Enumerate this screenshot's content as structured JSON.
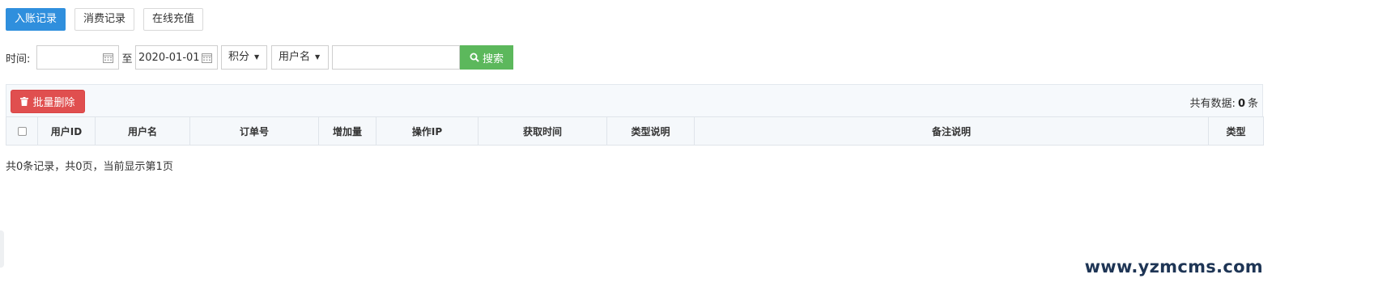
{
  "tabs": [
    {
      "label": "入账记录",
      "active": true
    },
    {
      "label": "消费记录",
      "active": false
    },
    {
      "label": "在线充值",
      "active": false
    }
  ],
  "search": {
    "time_label": "时间:",
    "start_date": "",
    "to_label": "至",
    "end_date": "2020-01-01",
    "type_select": "积分",
    "field_select": "用户名",
    "keyword": "",
    "search_button": "搜索"
  },
  "toolbar": {
    "batch_delete": "批量删除",
    "total_prefix": "共有数据:",
    "total_count": "0",
    "total_suffix": "条"
  },
  "table": {
    "columns": [
      "用户ID",
      "用户名",
      "订单号",
      "增加量",
      "操作IP",
      "获取时间",
      "类型说明",
      "备注说明",
      "类型"
    ],
    "rows": []
  },
  "pagination": {
    "summary": "共0条记录，共0页，当前显示第1页"
  },
  "watermark": "www.yzmcms.com",
  "colors": {
    "primary": "#2f8fdd",
    "success": "#5cb85c",
    "danger": "#e04f4f",
    "watermark": "#1e3555"
  }
}
